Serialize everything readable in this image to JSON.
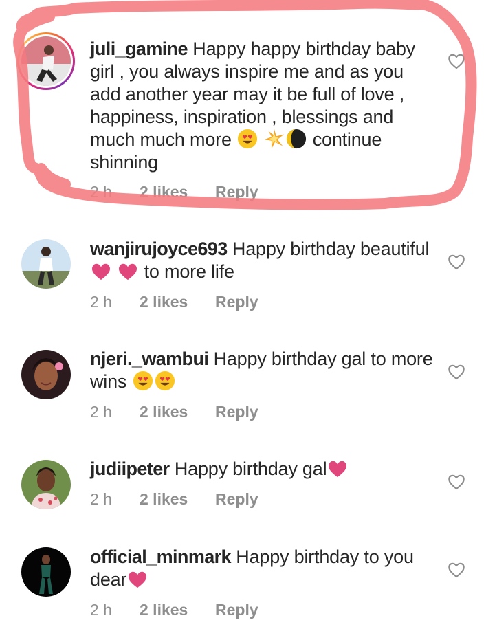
{
  "comments": [
    {
      "username": "juli_gamine",
      "text_parts": [
        "Happy happy birthday baby girl , you always inspire me and as you add another year may it be full of love , happiness, inspiration , blessings and much much more",
        "continue shinning"
      ],
      "time": "2 h",
      "likes": "2 likes",
      "reply": "Reply",
      "emojis": [
        "heart-eyes-emoji",
        "sparkle-emoji",
        "moon-emoji"
      ]
    },
    {
      "username": "wanjirujoyce693",
      "text_parts": [
        "Happy birthday beautiful",
        "to more life"
      ],
      "time": "2 h",
      "likes": "2 likes",
      "reply": "Reply",
      "emojis": [
        "pink-heart-emoji",
        "pink-heart-emoji"
      ]
    },
    {
      "username": "njeri._wambui",
      "text_parts": [
        "Happy birthday gal to more wins"
      ],
      "time": "2 h",
      "likes": "2 likes",
      "reply": "Reply",
      "emojis": [
        "heart-eyes-emoji",
        "heart-eyes-emoji"
      ]
    },
    {
      "username": "judiipeter",
      "text_parts": [
        "Happy birthday gal"
      ],
      "time": "2 h",
      "likes": "2 likes",
      "reply": "Reply",
      "emojis": [
        "pink-heart-emoji"
      ]
    },
    {
      "username": "official_minmark",
      "text_parts": [
        "Happy birthday to you dear"
      ],
      "time": "2 h",
      "likes": "2 likes",
      "reply": "Reply",
      "emojis": [
        "pink-heart-emoji"
      ]
    }
  ],
  "colors": {
    "annotation": "#f47a80",
    "text": "#262626",
    "meta": "#8e8e8e",
    "heart_emoji": "#e0457b",
    "emoji_face": "#f9c624"
  }
}
